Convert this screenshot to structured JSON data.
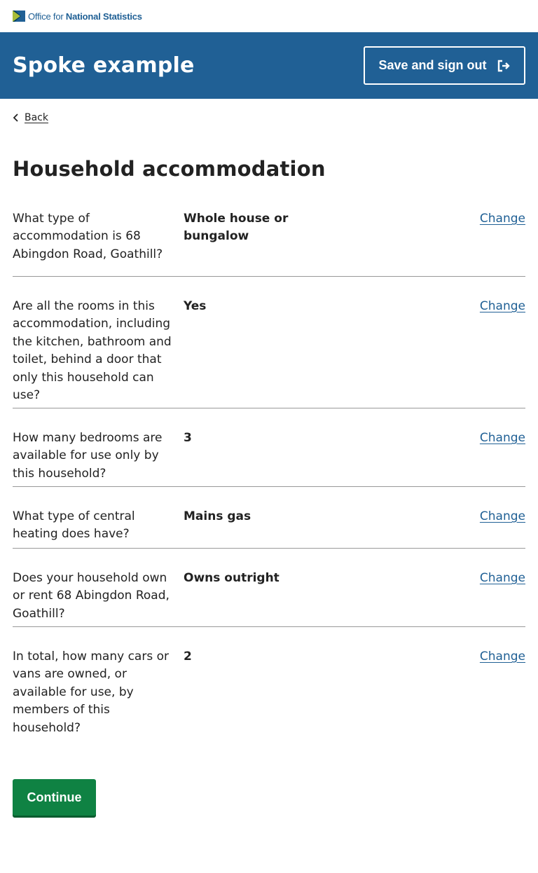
{
  "brand": {
    "logo_text_prefix": "Office for ",
    "logo_text_bold": "National Statistics",
    "accent": "#206095"
  },
  "header": {
    "title": "Spoke example",
    "signout_label": "Save and sign out",
    "signout_icon": "sign-out-icon"
  },
  "nav": {
    "back_label": "Back"
  },
  "page": {
    "title": "Household accommodation"
  },
  "summary": {
    "change_label": "Change",
    "rows": [
      {
        "question": "What type of accommodation is 68 Abingdon Road, Goathill?",
        "answer": "Whole house or bungalow"
      },
      {
        "question": "Are all the rooms in this accommodation, including the kitchen, bathroom and toilet, behind a door that only this household can use?",
        "answer": "Yes"
      },
      {
        "question": "How many bedrooms are available for use only by this household?",
        "answer": "3"
      },
      {
        "question": "What type of central heating does have?",
        "answer": "Mains gas"
      },
      {
        "question": "Does your household own or rent 68 Abingdon Road, Goathill?",
        "answer": "Owns outright"
      },
      {
        "question": "In total, how many cars or vans are owned, or available for use, by members of this household?",
        "answer": "2"
      }
    ]
  },
  "actions": {
    "continue_label": "Continue",
    "continue_color": "#0f8243"
  }
}
